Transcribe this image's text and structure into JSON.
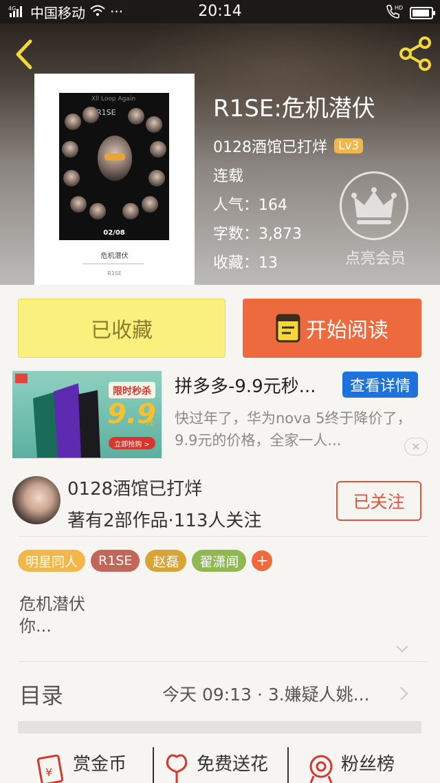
{
  "status_bar": {
    "carrier": "中国移动",
    "network": "4G",
    "time": "20:14",
    "hd": "HD"
  },
  "book": {
    "title": "R1SE:危机潜伏",
    "author": "0128酒馆已打烊",
    "level": "Lv3",
    "status": "连载",
    "popularity_label": "人气：",
    "popularity": "164",
    "word_count_label": "字数：",
    "word_count": "3,873",
    "favorites_label": "收藏：",
    "favorites": "13",
    "cover": {
      "poster_top_text": "Xll Loop Again",
      "poster_brand": "R1SE",
      "poster_date": "02/08",
      "caption": "危机潜伏",
      "caption_sub": "R1SE"
    }
  },
  "vip": {
    "label": "点亮会员"
  },
  "actions": {
    "favorite": "已收藏",
    "read": "开始阅读"
  },
  "ad": {
    "title": "拼多多-9.9元秒...",
    "cta": "查看详情",
    "description": "快过年了，华为nova 5终于降价了，9.9元的价格，全家一人...",
    "close": "✕",
    "image": {
      "badge": "限时秒杀",
      "price": "9.9",
      "unit": "元",
      "button": "立即抢购 >"
    }
  },
  "author_card": {
    "name": "0128酒馆已打烊",
    "stats": "著有2部作品·113人关注",
    "follow": "已关注"
  },
  "tags": [
    {
      "label": "明星同人",
      "color": "#f2b649"
    },
    {
      "label": "R1SE",
      "color": "#c3665a"
    },
    {
      "label": "赵磊",
      "color": "#d9a436"
    },
    {
      "label": "翟潇闻",
      "color": "#8fb84f"
    }
  ],
  "intro": {
    "line1": "危机潜伏",
    "line2": "你..."
  },
  "toc": {
    "label": "目录",
    "latest": "今天 09:13 · 3.嫌疑人姚..."
  },
  "bottom_bar": {
    "reward": "赏金币",
    "flower": "免费送花",
    "fans": "粉丝榜"
  },
  "colors": {
    "accent": "#ec6a3d",
    "favorite_bg": "#f9f07d",
    "ad_button": "#1d73db",
    "follow": "#e2553b"
  }
}
